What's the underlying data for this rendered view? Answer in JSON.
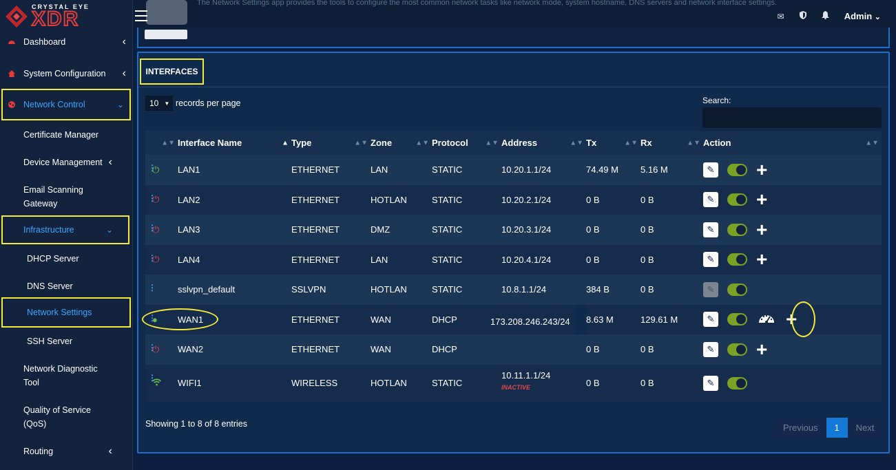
{
  "brand": {
    "tagline": "CRYSTAL EYE",
    "name": "XDR"
  },
  "header": {
    "note": "The Network Settings app provides the tools to configure the most common network tasks like network mode, system hostname, DNS servers and network interface settings.",
    "user": "Admin"
  },
  "sidebar": {
    "items": [
      {
        "label": "Dashboard"
      },
      {
        "label": "System Configuration"
      },
      {
        "label": "Network Control"
      },
      {
        "label": "Certificate Manager"
      },
      {
        "label": "Device Management"
      },
      {
        "label": "Email Scanning Gateway"
      },
      {
        "label": "Infrastructure"
      },
      {
        "label": "DHCP Server"
      },
      {
        "label": "DNS Server"
      },
      {
        "label": "Network Settings"
      },
      {
        "label": "SSH Server"
      },
      {
        "label": "Network Diagnostic Tool"
      },
      {
        "label": "Quality of Service (QoS)"
      },
      {
        "label": "Routing"
      }
    ]
  },
  "panel": {
    "title": "INTERFACES",
    "length_value": "10",
    "length_label": "records per page",
    "search_label": "Search:",
    "search_value": "",
    "columns": [
      "Interface Name",
      "Type",
      "Zone",
      "Protocol",
      "Address",
      "Tx",
      "Rx",
      "Action"
    ],
    "rows": [
      {
        "name": "LAN1",
        "type": "ETHERNET",
        "zone": "LAN",
        "protocol": "STATIC",
        "address": "10.20.1.1/24",
        "tx": "74.49 M",
        "rx": "5.16 M",
        "status": "inactive"
      },
      {
        "name": "LAN2",
        "type": "ETHERNET",
        "zone": "HOTLAN",
        "protocol": "STATIC",
        "address": "10.20.2.1/24",
        "tx": "0 B",
        "rx": "0 B",
        "status": "inactive"
      },
      {
        "name": "LAN3",
        "type": "ETHERNET",
        "zone": "DMZ",
        "protocol": "STATIC",
        "address": "10.20.3.1/24",
        "tx": "0 B",
        "rx": "0 B",
        "status": "inactive"
      },
      {
        "name": "LAN4",
        "type": "ETHERNET",
        "zone": "LAN",
        "protocol": "STATIC",
        "address": "10.20.4.1/24",
        "tx": "0 B",
        "rx": "0 B",
        "status": "inactive"
      },
      {
        "name": "sslvpn_default",
        "type": "SSLVPN",
        "zone": "HOTLAN",
        "protocol": "STATIC",
        "address": "10.8.1.1/24",
        "tx": "384 B",
        "rx": "0 B"
      },
      {
        "name": "WAN1",
        "type": "ETHERNET",
        "zone": "WAN",
        "protocol": "DHCP",
        "address": "173.208.246.243/24",
        "tx": "8.63 M",
        "rx": "129.61 M"
      },
      {
        "name": "WAN2",
        "type": "ETHERNET",
        "zone": "WAN",
        "protocol": "DHCP",
        "address": "",
        "tx": "0 B",
        "rx": "0 B"
      },
      {
        "name": "WIFI1",
        "type": "WIRELESS",
        "zone": "HOTLAN",
        "protocol": "STATIC",
        "address": "10.11.1.1/24",
        "address_note": "INACTIVE",
        "tx": "0 B",
        "rx": "0 B"
      }
    ],
    "info": "Showing 1 to 8 of 8 entries",
    "pager": {
      "previous": "Previous",
      "current": "1",
      "next": "Next"
    }
  },
  "colors": {
    "accent": "#1c6ecf",
    "highlight": "#f5ea3b",
    "toggle_on": "#7aa326",
    "error": "#e04545"
  }
}
